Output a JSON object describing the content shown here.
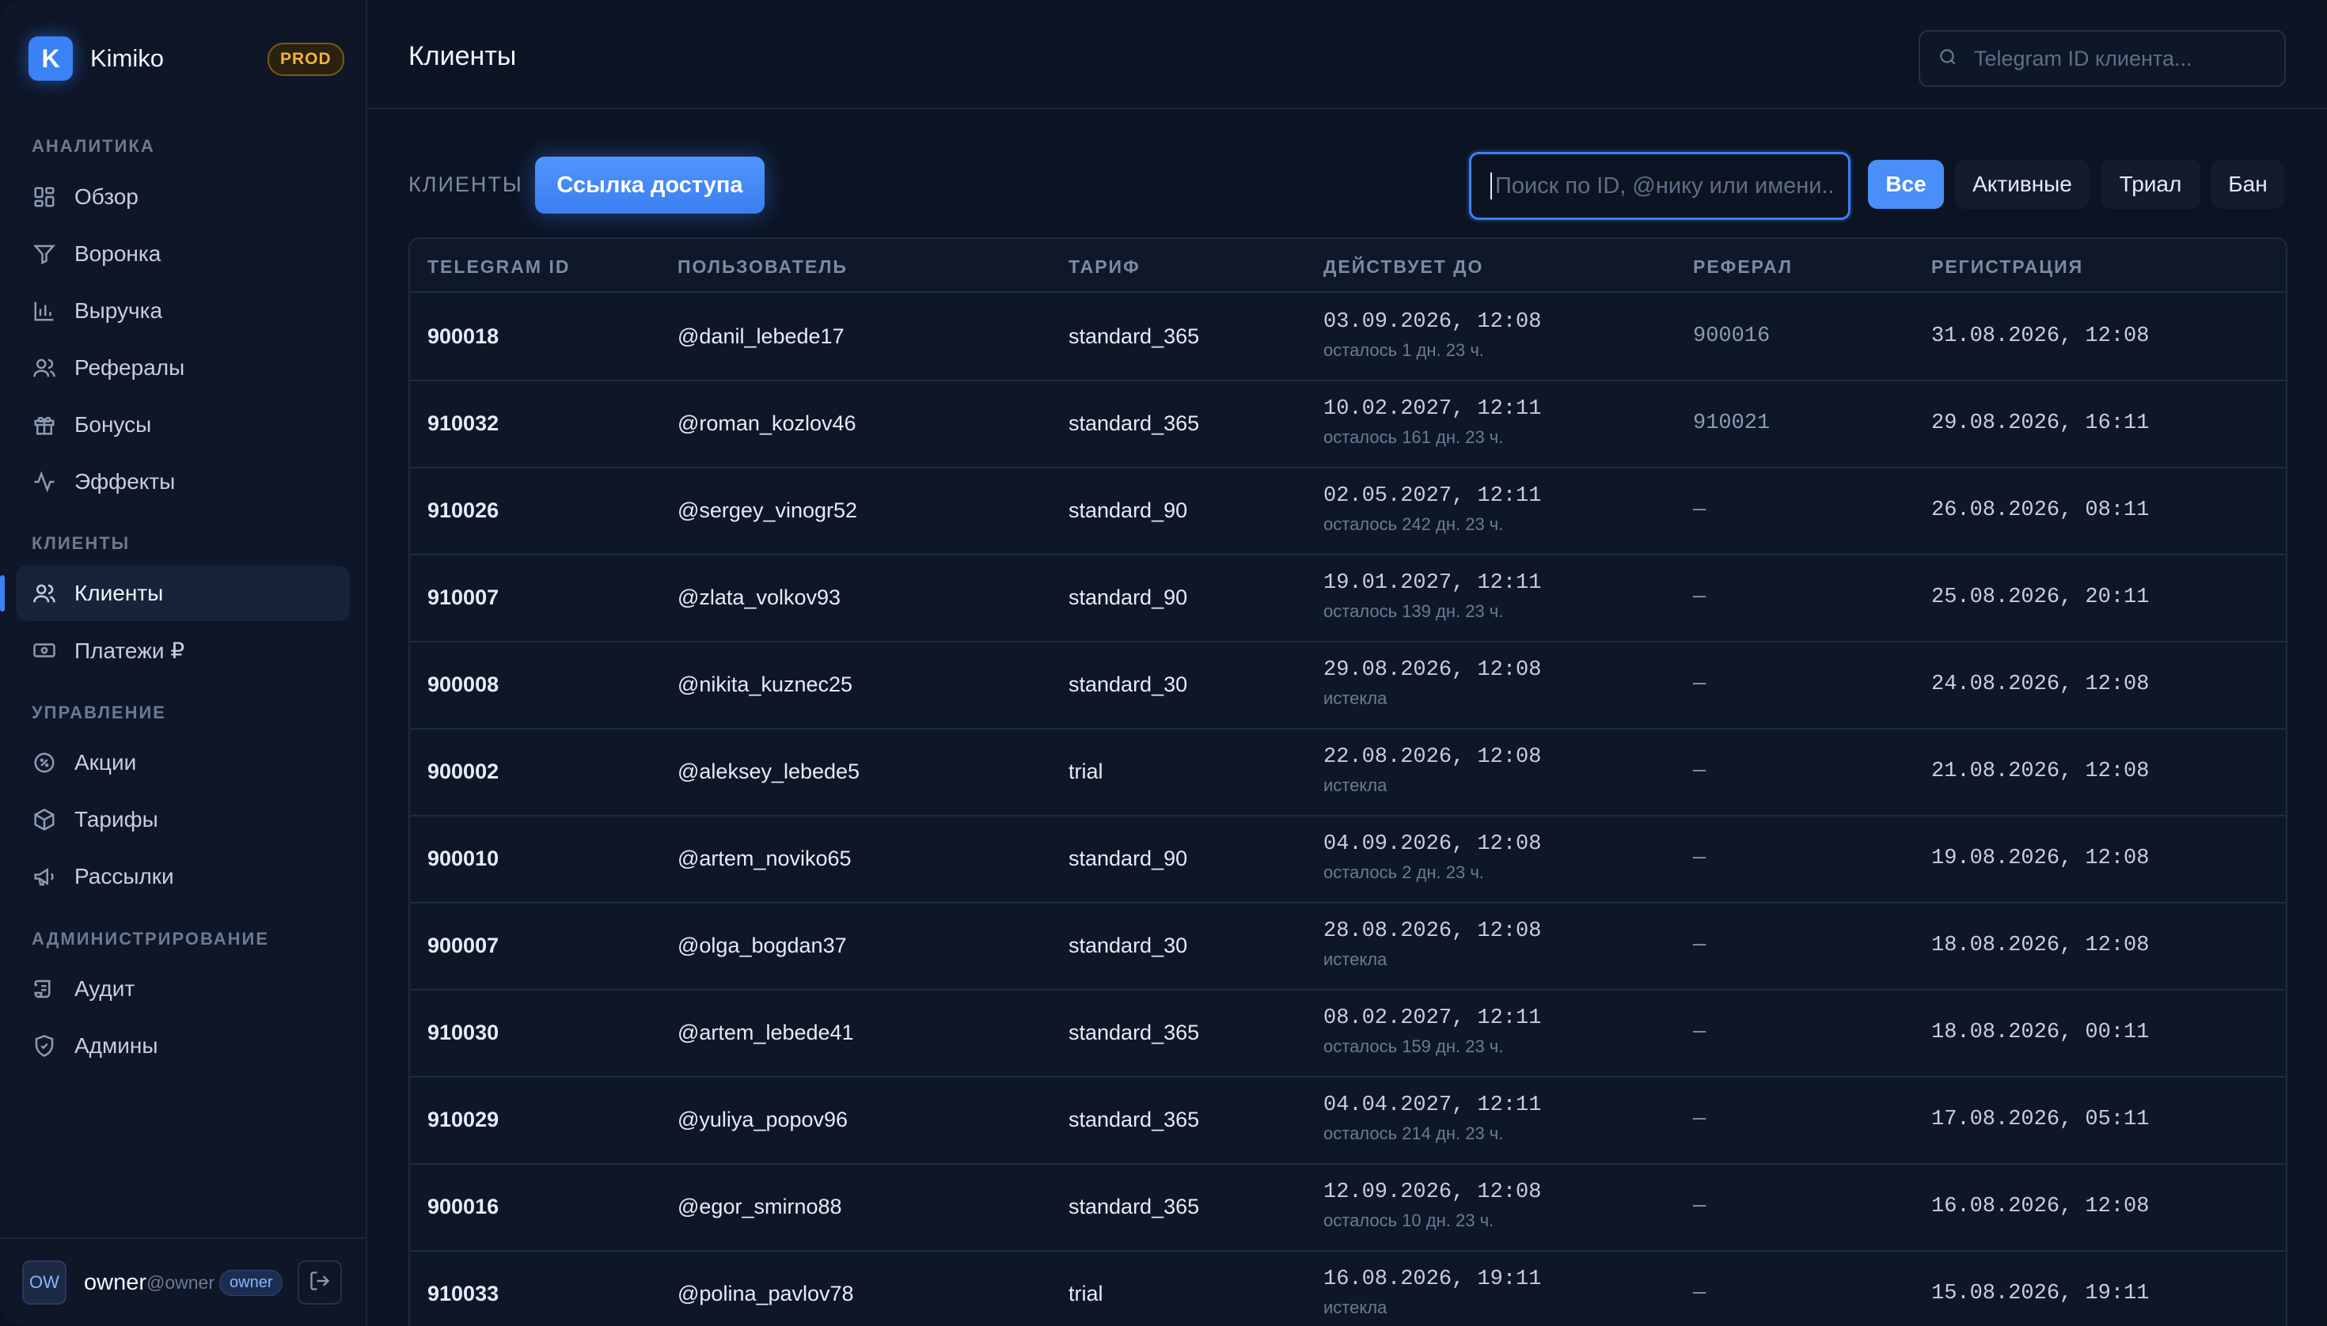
{
  "app": {
    "name": "Kimiko",
    "logo_letter": "K",
    "env": "PROD"
  },
  "colors": {
    "accent": "#3b82f6",
    "background": "#0c1424",
    "env_badge": "#f0b43a"
  },
  "sidebar": {
    "sections": [
      {
        "title": "АНАЛИТИКА",
        "items": [
          {
            "label": "Обзор",
            "icon": "grid-icon"
          },
          {
            "label": "Воронка",
            "icon": "filter-icon"
          },
          {
            "label": "Выручка",
            "icon": "bar-chart-icon"
          },
          {
            "label": "Рефералы",
            "icon": "users-icon"
          },
          {
            "label": "Бонусы",
            "icon": "gift-icon"
          },
          {
            "label": "Эффекты",
            "icon": "activity-icon"
          }
        ]
      },
      {
        "title": "КЛИЕНТЫ",
        "items": [
          {
            "label": "Клиенты",
            "icon": "user-icon",
            "active": true
          },
          {
            "label": "Платежи ₽",
            "icon": "banknote-icon"
          }
        ]
      },
      {
        "title": "УПРАВЛЕНИЕ",
        "items": [
          {
            "label": "Акции",
            "icon": "percent-badge-icon"
          },
          {
            "label": "Тарифы",
            "icon": "package-icon"
          },
          {
            "label": "Рассылки",
            "icon": "megaphone-icon"
          }
        ]
      },
      {
        "title": "АДМИНИСТРИРОВАНИЕ",
        "items": [
          {
            "label": "Аудит",
            "icon": "scroll-icon"
          },
          {
            "label": "Админы",
            "icon": "shield-icon"
          }
        ]
      }
    ],
    "footer": {
      "avatar": "OW",
      "name": "owner",
      "handle": "@owner",
      "role": "owner"
    }
  },
  "header": {
    "title": "Клиенты",
    "search_placeholder": "Telegram ID клиента..."
  },
  "toolbar": {
    "section_label": "КЛИЕНТЫ",
    "access_button": "Ссылка доступа",
    "search_placeholder": "Поиск по ID, @нику или имени...",
    "filters": [
      {
        "label": "Все",
        "active": true
      },
      {
        "label": "Активные",
        "active": false
      },
      {
        "label": "Триал",
        "active": false
      },
      {
        "label": "Бан",
        "active": false
      }
    ]
  },
  "table": {
    "columns": [
      "TELEGRAM ID",
      "ПОЛЬЗОВАТЕЛЬ",
      "ТАРИФ",
      "ДЕЙСТВУЕТ ДО",
      "РЕФЕРАЛ",
      "РЕГИСТРАЦИЯ"
    ],
    "rows": [
      {
        "id": "900018",
        "user": "@danil_lebede17",
        "tariff": "standard_365",
        "valid_until": "03.09.2026, 12:08",
        "remaining": "осталось 1 дн. 23 ч.",
        "referral": "900016",
        "registered": "31.08.2026, 12:08"
      },
      {
        "id": "910032",
        "user": "@roman_kozlov46",
        "tariff": "standard_365",
        "valid_until": "10.02.2027, 12:11",
        "remaining": "осталось 161 дн. 23 ч.",
        "referral": "910021",
        "registered": "29.08.2026, 16:11"
      },
      {
        "id": "910026",
        "user": "@sergey_vinogr52",
        "tariff": "standard_90",
        "valid_until": "02.05.2027, 12:11",
        "remaining": "осталось 242 дн. 23 ч.",
        "referral": "—",
        "registered": "26.08.2026, 08:11"
      },
      {
        "id": "910007",
        "user": "@zlata_volkov93",
        "tariff": "standard_90",
        "valid_until": "19.01.2027, 12:11",
        "remaining": "осталось 139 дн. 23 ч.",
        "referral": "—",
        "registered": "25.08.2026, 20:11"
      },
      {
        "id": "900008",
        "user": "@nikita_kuznec25",
        "tariff": "standard_30",
        "valid_until": "29.08.2026, 12:08",
        "remaining": "истекла",
        "referral": "—",
        "registered": "24.08.2026, 12:08"
      },
      {
        "id": "900002",
        "user": "@aleksey_lebede5",
        "tariff": "trial",
        "valid_until": "22.08.2026, 12:08",
        "remaining": "истекла",
        "referral": "—",
        "registered": "21.08.2026, 12:08"
      },
      {
        "id": "900010",
        "user": "@artem_noviko65",
        "tariff": "standard_90",
        "valid_until": "04.09.2026, 12:08",
        "remaining": "осталось 2 дн. 23 ч.",
        "referral": "—",
        "registered": "19.08.2026, 12:08"
      },
      {
        "id": "900007",
        "user": "@olga_bogdan37",
        "tariff": "standard_30",
        "valid_until": "28.08.2026, 12:08",
        "remaining": "истекла",
        "referral": "—",
        "registered": "18.08.2026, 12:08"
      },
      {
        "id": "910030",
        "user": "@artem_lebede41",
        "tariff": "standard_365",
        "valid_until": "08.02.2027, 12:11",
        "remaining": "осталось 159 дн. 23 ч.",
        "referral": "—",
        "registered": "18.08.2026, 00:11"
      },
      {
        "id": "910029",
        "user": "@yuliya_popov96",
        "tariff": "standard_365",
        "valid_until": "04.04.2027, 12:11",
        "remaining": "осталось 214 дн. 23 ч.",
        "referral": "—",
        "registered": "17.08.2026, 05:11"
      },
      {
        "id": "900016",
        "user": "@egor_smirno88",
        "tariff": "standard_365",
        "valid_until": "12.09.2026, 12:08",
        "remaining": "осталось 10 дн. 23 ч.",
        "referral": "—",
        "registered": "16.08.2026, 12:08"
      },
      {
        "id": "910033",
        "user": "@polina_pavlov78",
        "tariff": "trial",
        "valid_until": "16.08.2026, 19:11",
        "remaining": "истекла",
        "referral": "—",
        "registered": "15.08.2026, 19:11"
      }
    ]
  }
}
